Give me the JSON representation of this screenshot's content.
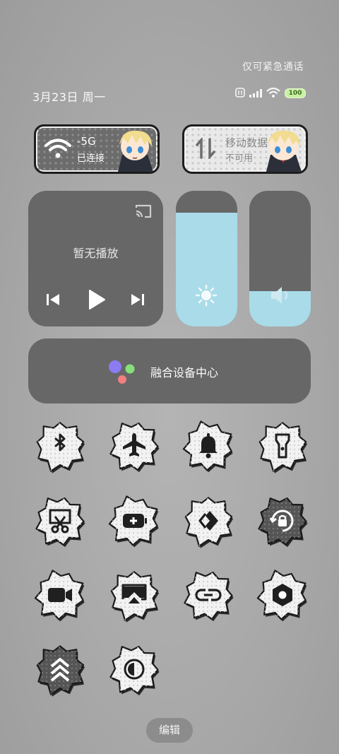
{
  "status": {
    "emergency_text": "仅可紧急通话",
    "date_text": "3月23日 周一",
    "battery_level": "100"
  },
  "network": {
    "wifi": {
      "name": "-5G",
      "status": "已连接",
      "icon": "wifi-icon"
    },
    "mobile": {
      "name": "移动数据",
      "status": "不可用",
      "icon": "mobile-data-icon"
    }
  },
  "media": {
    "label": "暂无播放",
    "controls": [
      "previous-icon",
      "play-icon",
      "next-icon"
    ],
    "cast_icon": "cast-icon"
  },
  "sliders": {
    "brightness": {
      "level": 0.84,
      "icon": "sun-icon"
    },
    "volume": {
      "level": 0.26,
      "icon": "volume-icon"
    },
    "fill_color": "#aadbe8"
  },
  "device_hub": {
    "label": "融合设备中心"
  },
  "toggles": [
    {
      "name": "bluetooth",
      "icon": "bluetooth-icon",
      "on": false
    },
    {
      "name": "airplane-mode",
      "icon": "airplane-icon",
      "on": false
    },
    {
      "name": "sound",
      "icon": "bell-icon",
      "on": false
    },
    {
      "name": "flashlight",
      "icon": "flashlight-icon",
      "on": false
    },
    {
      "name": "screenshot",
      "icon": "scissors-icon",
      "on": false
    },
    {
      "name": "battery-saver",
      "icon": "battery-saver-icon",
      "on": false
    },
    {
      "name": "nearby-share",
      "icon": "share-icon",
      "on": false
    },
    {
      "name": "rotation-lock",
      "icon": "rotation-lock-icon",
      "on": true
    },
    {
      "name": "screen-recorder",
      "icon": "video-icon",
      "on": false
    },
    {
      "name": "screen-cast",
      "icon": "cast-screen-icon",
      "on": false
    },
    {
      "name": "link",
      "icon": "link-icon",
      "on": false
    },
    {
      "name": "settings",
      "icon": "hexagon-icon",
      "on": false
    },
    {
      "name": "performance",
      "icon": "chevrons-up-icon",
      "on": true
    },
    {
      "name": "dark-mode",
      "icon": "contrast-icon",
      "on": false
    }
  ],
  "edit_label": "编辑",
  "colors": {
    "tile_on": "#555555",
    "tile_off": "#f2f2f2",
    "hub_dot_purple": "#8c7cf2",
    "hub_dot_green": "#86e07a",
    "hub_dot_pink": "#f27f7f"
  }
}
